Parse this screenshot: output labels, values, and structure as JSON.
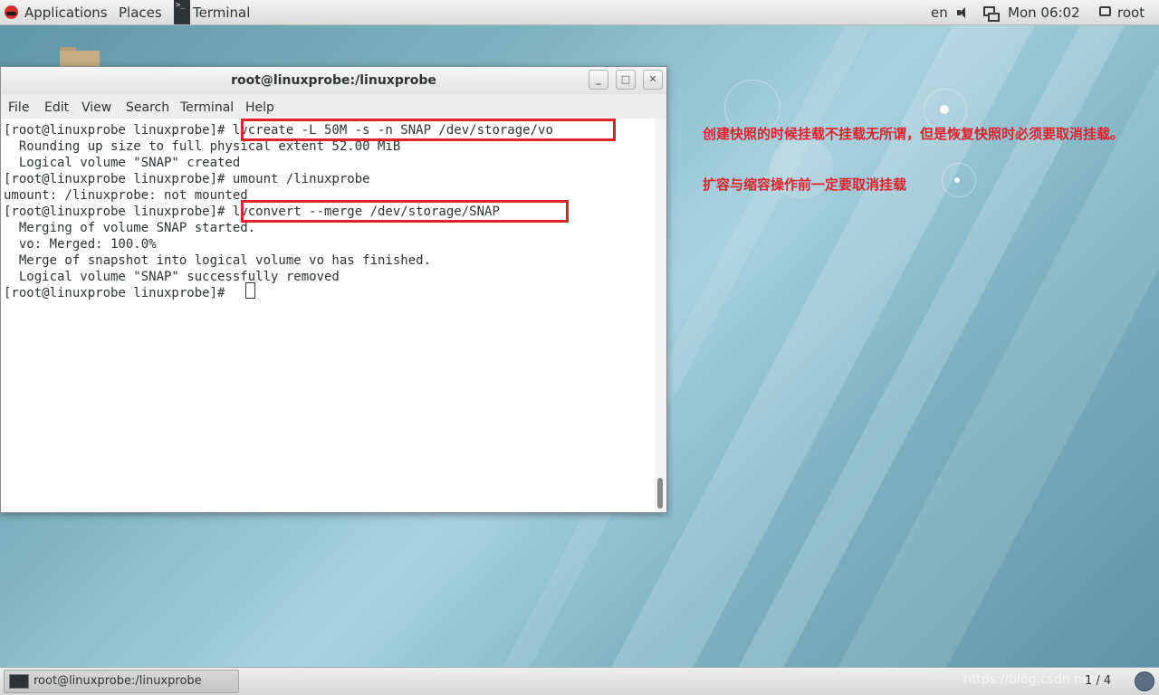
{
  "top_panel": {
    "applications": "Applications",
    "places": "Places",
    "terminal_task": "Terminal",
    "language": "en",
    "clock": "Mon 06:02",
    "user": "root"
  },
  "window": {
    "title": "root@linuxprobe:/linuxprobe",
    "minimize": "_",
    "maximize": "□",
    "close": "✕",
    "menu": [
      "File",
      "Edit",
      "View",
      "Search",
      "Terminal",
      "Help"
    ]
  },
  "terminal_lines": [
    "[root@linuxprobe linuxprobe]# lvcreate -L 50M -s -n SNAP /dev/storage/vo",
    "  Rounding up size to full physical extent 52.00 MiB",
    "  Logical volume \"SNAP\" created",
    "[root@linuxprobe linuxprobe]# umount /linuxprobe",
    "umount: /linuxprobe: not mounted",
    "[root@linuxprobe linuxprobe]# lvconvert --merge /dev/storage/SNAP",
    "  Merging of volume SNAP started.",
    "  vo: Merged: 100.0%",
    "  Merge of snapshot into logical volume vo has finished.",
    "  Logical volume \"SNAP\" successfully removed",
    "[root@linuxprobe linuxprobe]# "
  ],
  "annotation": {
    "line1": "创建快照的时候挂载不挂载无所谓，但是恢复快照时必须要取消挂载。",
    "line2": "扩容与缩容操作前一定要取消挂载"
  },
  "bottom_panel": {
    "task_label": "root@linuxprobe:/linuxprobe",
    "watermark": "https://blog.csdn.net/...",
    "workspace": "1 / 4"
  },
  "colors": {
    "highlight": "#e0222b",
    "annotation": "#e0222b"
  }
}
